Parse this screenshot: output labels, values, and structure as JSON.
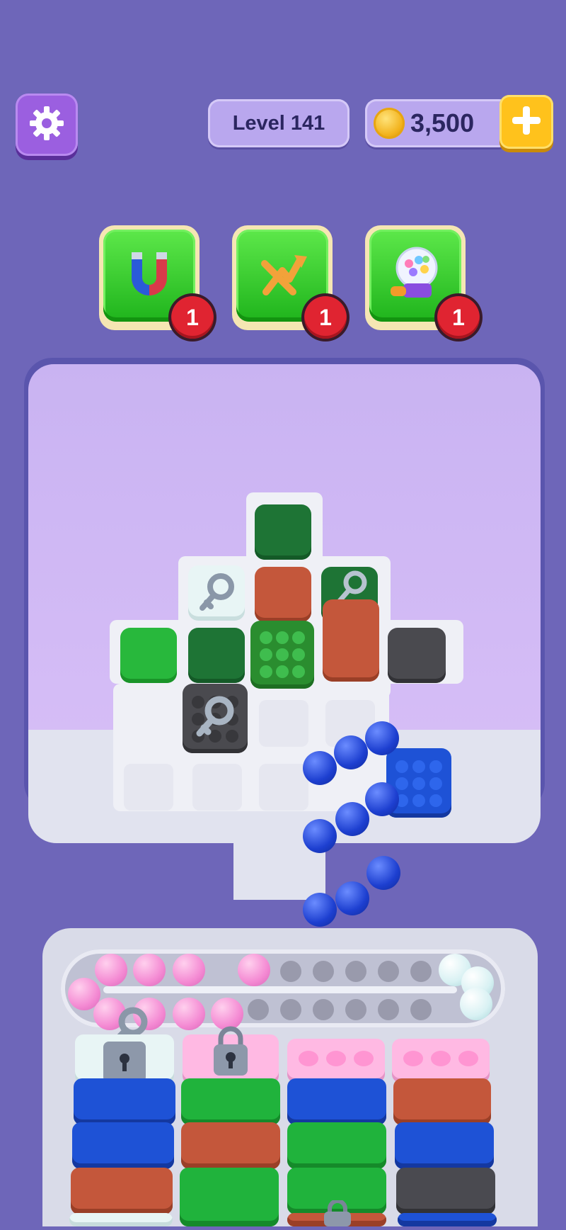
{
  "header": {
    "settings_icon": "gear-icon",
    "level_label": "Level 141",
    "coins": "3,500",
    "coin_icon": "coin-icon",
    "add_coins_icon": "plus-icon"
  },
  "boosters": [
    {
      "name": "magnet",
      "icon": "magnet-icon",
      "count": "1"
    },
    {
      "name": "shuffle",
      "icon": "shuffle-arrows-icon",
      "count": "1"
    },
    {
      "name": "gumball",
      "icon": "gumball-machine-icon",
      "count": "1"
    }
  ],
  "colors": {
    "background": "#6e66b9",
    "booster_green": "#2bc22a",
    "badge_red": "#e02431",
    "ball_blue": "#1d3fd0",
    "ball_pink": "#f48ad3"
  },
  "board": {
    "keys": [
      "key-icon",
      "key-icon",
      "key-icon"
    ],
    "locks": [
      "padlock-icon",
      "padlock-icon"
    ]
  }
}
